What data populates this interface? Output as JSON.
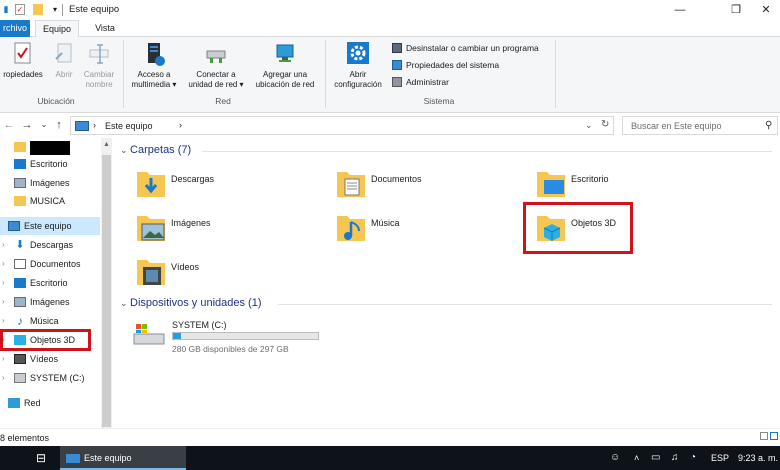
{
  "window": {
    "title": "Este equipo",
    "minimize": "—",
    "maximize": "❐",
    "close": "✕"
  },
  "tabs": {
    "archivo": "rchivo",
    "equipo": "Equipo",
    "vista": "Vista"
  },
  "ribbon": {
    "ubicacion": {
      "label": "Ubicación",
      "propiedades": "ropiedades",
      "abrir": "Abrir",
      "cambiar_nombre_1": "Cambiar",
      "cambiar_nombre_2": "nombre"
    },
    "red": {
      "label": "Red",
      "multimedia_1": "Acceso a",
      "multimedia_2": "multimedia ▾",
      "unidad_1": "Conectar a",
      "unidad_2": "unidad de red ▾",
      "ubicacion_1": "Agregar una",
      "ubicacion_2": "ubicación de red"
    },
    "sistema": {
      "label": "Sistema",
      "abrir_config_1": "Abrir",
      "abrir_config_2": "configuración",
      "desinstalar": "Desinstalar o cambiar un programa",
      "propiedades": "Propiedades del sistema",
      "administrar": "Administrar"
    }
  },
  "address": {
    "crumb": "Este equipo",
    "separator": "›",
    "search_placeholder": "Buscar en Este equipo"
  },
  "nav": {
    "items": [
      {
        "label": "Escritorio"
      },
      {
        "label": "Imágenes"
      },
      {
        "label": "MUSICA"
      },
      {
        "label": "Este equipo"
      },
      {
        "label": "Descargas"
      },
      {
        "label": "Documentos"
      },
      {
        "label": "Escritorio"
      },
      {
        "label": "Imágenes"
      },
      {
        "label": "Música"
      },
      {
        "label": "Objetos 3D"
      },
      {
        "label": "Vídeos"
      },
      {
        "label": "SYSTEM (C:)"
      },
      {
        "label": "Red"
      }
    ]
  },
  "content": {
    "folders_header": "Carpetas (7)",
    "folders": [
      {
        "label": "Descargas"
      },
      {
        "label": "Documentos"
      },
      {
        "label": "Escritorio"
      },
      {
        "label": "Imágenes"
      },
      {
        "label": "Música"
      },
      {
        "label": "Objetos 3D"
      },
      {
        "label": "Vídeos"
      }
    ],
    "devices_header": "Dispositivos y unidades (1)",
    "drive": {
      "name": "SYSTEM (C:)",
      "space": "280 GB disponibles de 297 GB",
      "used_fraction": 0.057
    }
  },
  "status": {
    "count": "8 elementos"
  },
  "taskbar": {
    "active_app": "Este equipo",
    "lang": "ESP",
    "time": "9:23 a. m."
  },
  "colors": {
    "accent": "#1979ca",
    "highlight": "#cce8ff",
    "red": "#d0131a",
    "folder": "#f6c652"
  }
}
